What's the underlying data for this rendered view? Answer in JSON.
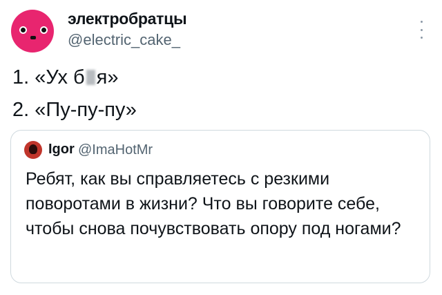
{
  "author": {
    "display_name": "электробратцы",
    "handle": "@electric_cake_",
    "avatar_color": "#e8256f"
  },
  "tweet": {
    "line1_prefix": "1. «Ух б",
    "line1_suffix": "я»",
    "line2": "2. «Пу-пу-пу»"
  },
  "quoted": {
    "display_name": "Igor",
    "handle": "@ImaHotMr",
    "text": "Ребят, как вы справляетесь с резкими поворотами в жизни? Что вы говорите себе, чтобы снова почувствовать опору под ногами?"
  },
  "colors": {
    "text": "#0f1419",
    "secondary": "#536471",
    "border": "#cfd9de"
  }
}
